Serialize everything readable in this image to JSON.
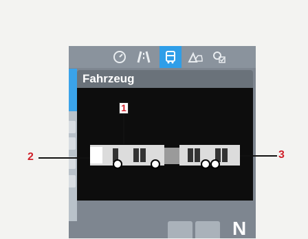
{
  "tabs": [
    {
      "name": "speedometer",
      "active": false
    },
    {
      "name": "road",
      "active": false
    },
    {
      "name": "bus",
      "active": true
    },
    {
      "name": "warning-car",
      "active": false
    },
    {
      "name": "settings-check",
      "active": false
    }
  ],
  "panel": {
    "title": "Fahrzeug"
  },
  "callouts": {
    "one": "1",
    "two": "2",
    "three": "3"
  },
  "status": {
    "gear": "N"
  },
  "colors": {
    "accent": "#2f9ee8",
    "callout": "#d0202a",
    "panel_bg": "#0d0d0d"
  }
}
